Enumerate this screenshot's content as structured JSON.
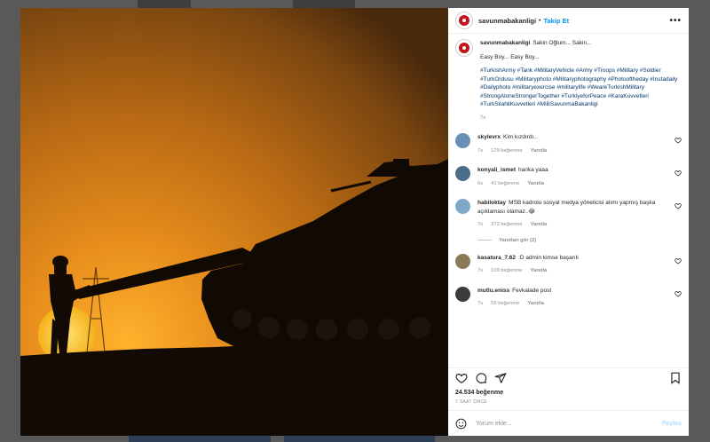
{
  "post": {
    "username": "savunmabakanligi",
    "follow_label": "Takip Et",
    "more_label": "•••",
    "caption_line1": "Sakin Oğlum... Sakin...",
    "caption_line2": "Easy Boy... Easy Boy...",
    "hashtags": "#TurkishArmy #Tank #MilitaryVehicle #Army #Troops #Military #Soldier #TurkOrdusu #Militaryphoto #Militaryphotography #Photooftheday #Instadaily #Dailyphoto #militaryexercise #militarylife #WeareTurkishMilitary #StrongAloneStrongerTogether #TurkiyeforPeace #KaraKuvvetleri #TurkSilahliKuvvetleri #MilliSavunmaBakanligi",
    "caption_time": "7s"
  },
  "comments": [
    {
      "user": "skylevrx",
      "text": "Kim kızdırdı..",
      "time": "7s",
      "likes": "129 beğenme",
      "reply": "Yanıtla",
      "avatar_color": "#6a8fb5"
    },
    {
      "user": "konyali_ismet",
      "text": "harika yaaa",
      "time": "6s",
      "likes": "41 beğenme",
      "reply": "Yanıtla",
      "avatar_color": "#4b6d8a"
    },
    {
      "user": "habiloktay",
      "text": "MSB kadrolu sosyal medya yöneticisi alımı yapmış başka açıklaması olamaz..😂",
      "time": "7s",
      "likes": "272 beğenme",
      "reply": "Yanıtla",
      "avatar_color": "#7fa9c9",
      "view_replies": "Yanıtları gör (2)"
    },
    {
      "user": "kasatura_7.62",
      "text": ":D admin kimse başarılı",
      "time": "7s",
      "likes": "109 beğenme",
      "reply": "Yanıtla",
      "avatar_color": "#8a7a55"
    },
    {
      "user": "mutlu.eniss",
      "text": "Fevkalade post",
      "time": "7s",
      "likes": "55 beğenme",
      "reply": "Yanıtla",
      "avatar_color": "#3c3c3c"
    }
  ],
  "footer": {
    "likes_text": "24.534 beğenme",
    "timestamp": "7 SAAT ÖNCE",
    "comment_placeholder": "Yorum ekle...",
    "post_label": "Paylaş"
  },
  "colors": {
    "accent": "#0095f6",
    "brand_red": "#c0151b",
    "sky_top": "#5e3a10",
    "sky_mid": "#d8881c",
    "sun": "#ffc83a"
  }
}
